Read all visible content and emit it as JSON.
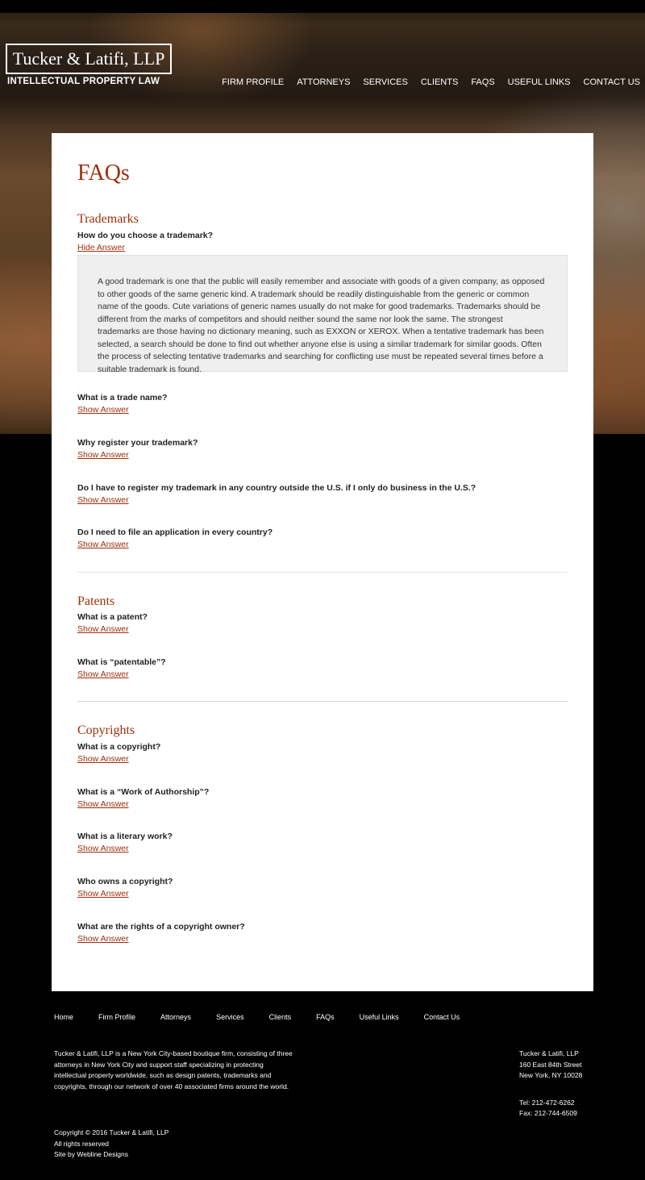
{
  "header": {
    "logo_name": "Tucker & Latifi, LLP",
    "tagline": "INTELLECTUAL PROPERTY LAW",
    "nav": [
      "FIRM PROFILE",
      "ATTORNEYS",
      "SERVICES",
      "CLIENTS",
      "FAQS",
      "USEFUL LINKS",
      "CONTACT US"
    ]
  },
  "main": {
    "title": "FAQs",
    "sections": [
      {
        "title": "Trademarks",
        "questions": [
          {
            "question": "How do you choose a trademark?",
            "toggle": "Hide Answer",
            "answer": "A good trademark is one that the public will easily remember and associate with goods of a given company, as opposed to other goods of the same generic kind. A trademark should be readily distinguishable from the generic or common name of the goods. Cute variations of generic names usually do not make for good trademarks. Trademarks should be different from the marks of competitors and should neither sound the same nor look the same. The strongest trademarks are those having no dictionary meaning, such as EXXON or XEROX. When a tentative trademark has been selected, a search should be done to find out whether anyone else is using a similar trademark for similar goods. Often the process of selecting tentative trademarks and searching for conflicting use must be repeated several times before a suitable trademark is found."
          },
          {
            "question": "What is a trade name?",
            "toggle": "Show Answer"
          },
          {
            "question": "Why register your trademark?",
            "toggle": "Show Answer"
          },
          {
            "question": "Do I have to register my trademark in any country outside the U.S. if I only do business in the U.S.?",
            "toggle": "Show Answer"
          },
          {
            "question": "Do I need to file an application in every country?",
            "toggle": "Show Answer"
          }
        ]
      },
      {
        "title": "Patents",
        "questions": [
          {
            "question": "What is a patent?",
            "toggle": "Show Answer"
          },
          {
            "question": "What is “patentable”?",
            "toggle": "Show Answer"
          }
        ]
      },
      {
        "title": "Copyrights",
        "questions": [
          {
            "question": "What is a copyright?",
            "toggle": "Show Answer"
          },
          {
            "question": "What is a “Work of Authorship”?",
            "toggle": "Show Answer"
          },
          {
            "question": "What is a literary work?",
            "toggle": "Show Answer"
          },
          {
            "question": "Who owns a copyright?",
            "toggle": "Show Answer"
          },
          {
            "question": "What are the rights of a copyright owner?",
            "toggle": "Show Answer"
          }
        ]
      }
    ]
  },
  "footer": {
    "nav": [
      "Home",
      "Firm Profile",
      "Attorneys",
      "Services",
      "Clients",
      "FAQs",
      "Useful Links",
      "Contact Us"
    ],
    "about": "Tucker & Latifi, LLP is a New York City-based boutique firm, consisting of three attorneys in New York City and support staff specializing in protecting intellectual property worldwide, such as design patents, trademarks and copyrights, through our network of over 40 associated firms around the world.",
    "address": [
      "Tucker & Latifi, LLP",
      "160 East 84th Street",
      "New York, NY 10028"
    ],
    "tel": "Tel: 212-472-6262",
    "fax": "Fax: 212-744-6509",
    "copyright": "Copyright © 2016 Tucker & Latifi, LLP",
    "rights": "All rights reserved",
    "credit": "Site by Webline Designs"
  }
}
